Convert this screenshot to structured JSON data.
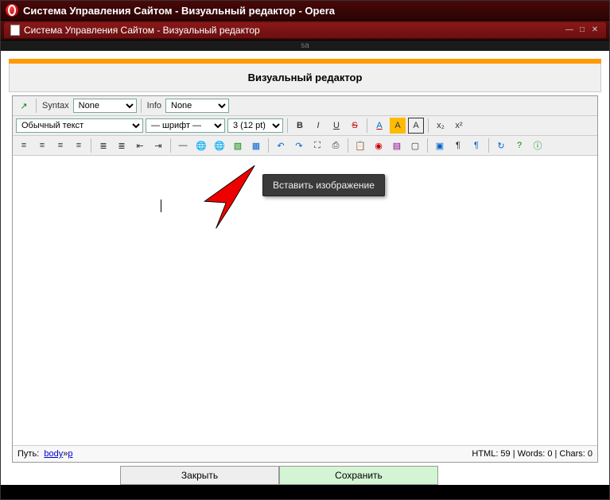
{
  "browser": {
    "title": "Система Управления Сайтом - Визуальный редактор - Opera",
    "tab_title": "Система Управления Сайтом - Визуальный редактор",
    "sa_label": "sa"
  },
  "editor": {
    "title": "Визуальный редактор",
    "syntax_label": "Syntax",
    "syntax_value": "None",
    "info_label": "Info",
    "info_value": "None",
    "format_value": "Обычный текст",
    "font_value": "— шрифт —",
    "size_value": "3 (12 pt)",
    "tooltip": "Вставить изображение"
  },
  "path": {
    "label": "Путь:",
    "body": "body",
    "sep": " » ",
    "p": "p",
    "stats": "HTML: 59 | Words: 0 | Chars: 0"
  },
  "buttons": {
    "close": "Закрыть",
    "save": "Сохранить"
  },
  "icons": {
    "expand": "↗",
    "bold": "B",
    "italic": "I",
    "underline": "U",
    "strike": "S",
    "fontcolor": "A",
    "bgcolor": "A",
    "hilite": "A",
    "sub": "x₂",
    "sup": "x²",
    "alignl": "≡",
    "alignc": "≡",
    "alignr": "≡",
    "alignj": "≡",
    "ol": "≣",
    "ul": "≣",
    "outdent": "⇤",
    "indent": "⇥",
    "hr": "—",
    "link": "🌐",
    "unlink": "🌐",
    "image": "▧",
    "table": "▦",
    "undo": "↶",
    "redo": "↷",
    "full": "⛶",
    "print": "⎙",
    "paste": "📋",
    "circle": "◉",
    "grid": "▤",
    "box": "▢",
    "view": "▣",
    "pilc": "¶",
    "pilc2": "¶",
    "refresh": "↻",
    "help": "?",
    "info": "ⓘ",
    "minimize": "—",
    "maximize": "□",
    "close_win": "✕"
  }
}
